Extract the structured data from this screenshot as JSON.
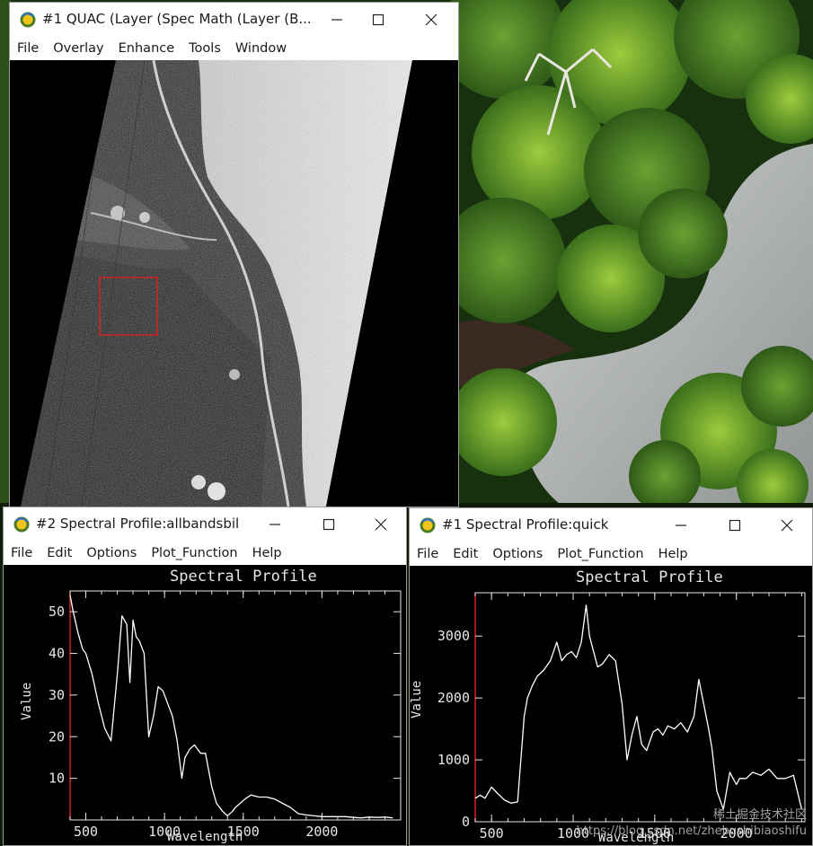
{
  "windows": {
    "image_viewer": {
      "title": "#1 QUAC (Layer (Spec Math (Layer (B...",
      "menu": [
        "File",
        "Overlay",
        "Enhance",
        "Tools",
        "Window"
      ]
    },
    "profile_left": {
      "title": "#2 Spectral Profile:allbandsbil",
      "menu": [
        "File",
        "Edit",
        "Options",
        "Plot_Function",
        "Help"
      ]
    },
    "profile_right": {
      "title": "#1 Spectral Profile:quick",
      "menu": [
        "File",
        "Edit",
        "Options",
        "Plot_Function",
        "Help"
      ]
    }
  },
  "icons": {
    "minimize": "minimize-icon",
    "maximize": "maximize-icon",
    "close": "close-icon",
    "app": "envi-app-icon"
  },
  "colors": {
    "roi_box": "#d62020",
    "plot_axis": "#e6e6e6",
    "y_axis_accent": "#d62020",
    "curve": "#ffffff"
  },
  "chart_data": [
    {
      "type": "line",
      "title": "Spectral Profile",
      "xlabel": "Wavelength",
      "ylabel": "Value",
      "xlim": [
        400,
        2500
      ],
      "ylim": [
        0,
        55
      ],
      "x_ticks": [
        "500",
        "1000",
        "1500",
        "2000"
      ],
      "y_ticks": [
        "10",
        "20",
        "30",
        "40",
        "50"
      ],
      "series": [
        {
          "x": [
            400,
            420,
            450,
            480,
            500,
            540,
            580,
            620,
            660,
            700,
            730,
            760,
            780,
            800,
            820,
            840,
            870,
            900,
            930,
            960,
            990,
            1020,
            1050,
            1080,
            1110,
            1130,
            1160,
            1190,
            1230,
            1260,
            1300,
            1330,
            1370,
            1400,
            1430,
            1450,
            1480,
            1510,
            1550,
            1600,
            1650,
            1700,
            1750,
            1800,
            1850,
            1900,
            1950,
            2000,
            2050,
            2100,
            2150,
            2200,
            2250,
            2300,
            2350,
            2400,
            2450
          ],
          "y": [
            54,
            50,
            45,
            41,
            40,
            35,
            28,
            22,
            19,
            35,
            49,
            47,
            33,
            48,
            44,
            43,
            40,
            20,
            25,
            32,
            31,
            28,
            25,
            19,
            10,
            15,
            17,
            18,
            16,
            16,
            8,
            4,
            2,
            1,
            2,
            3,
            4,
            5,
            6,
            5.5,
            5.5,
            5,
            4,
            3,
            1.5,
            1.2,
            1,
            0.8,
            0.8,
            0.8,
            0.8,
            0.6,
            0.5,
            0.7,
            0.6,
            0.7,
            0.5
          ]
        }
      ]
    },
    {
      "type": "line",
      "title": "Spectral Profile",
      "xlabel": "Wavelength",
      "ylabel": "Value",
      "xlim": [
        400,
        2420
      ],
      "ylim": [
        0,
        3700
      ],
      "x_ticks": [
        "500",
        "1000",
        "1500",
        "2000"
      ],
      "y_ticks": [
        "0",
        "1000",
        "2000",
        "3000"
      ],
      "series": [
        {
          "x": [
            400,
            430,
            460,
            500,
            540,
            580,
            620,
            660,
            700,
            720,
            750,
            780,
            820,
            860,
            900,
            930,
            960,
            990,
            1020,
            1050,
            1080,
            1100,
            1120,
            1150,
            1180,
            1220,
            1260,
            1300,
            1330,
            1360,
            1390,
            1420,
            1450,
            1470,
            1490,
            1520,
            1550,
            1580,
            1620,
            1660,
            1700,
            1740,
            1770,
            1800,
            1830,
            1850,
            1880,
            1920,
            1960,
            2000,
            2020,
            2060,
            2100,
            2150,
            2200,
            2250,
            2300,
            2350,
            2400
          ],
          "y": [
            380,
            430,
            380,
            560,
            450,
            350,
            300,
            320,
            1700,
            2000,
            2200,
            2350,
            2450,
            2600,
            2900,
            2600,
            2700,
            2750,
            2650,
            2900,
            3500,
            3000,
            2800,
            2500,
            2550,
            2700,
            2600,
            1900,
            1000,
            1400,
            1700,
            1250,
            1150,
            1300,
            1450,
            1500,
            1400,
            1550,
            1500,
            1600,
            1450,
            1700,
            2300,
            1900,
            1500,
            1200,
            500,
            200,
            800,
            600,
            700,
            700,
            800,
            750,
            850,
            700,
            700,
            750,
            200
          ]
        }
      ]
    }
  ],
  "watermark": {
    "line1": "稀土掘金技术社区",
    "line2": "https://blog.csdn.net/zhebushibiaoshifu"
  }
}
